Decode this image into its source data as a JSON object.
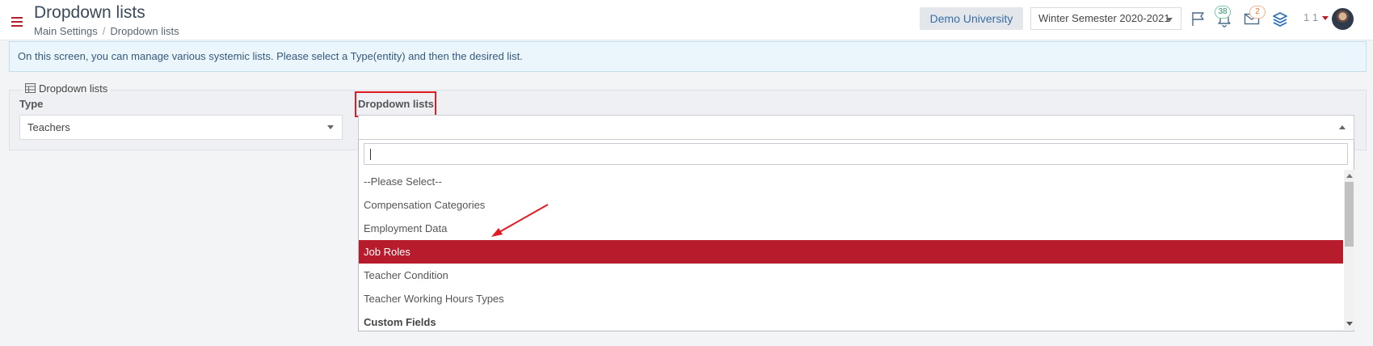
{
  "header": {
    "title": "Dropdown lists",
    "breadcrumb": [
      "Main Settings",
      "Dropdown lists"
    ],
    "university": "Demo University",
    "semester": "Winter Semester 2020-2021",
    "notifications_count": "38",
    "messages_count": "2",
    "user_number": "1 1"
  },
  "info": {
    "text": "On this screen, you can manage various systemic lists. Please select a Type(entity) and then the desired list."
  },
  "panel": {
    "legend": "Dropdown lists",
    "type_label": "Type",
    "type_value": "Teachers",
    "list_label": "Dropdown lists",
    "list_value": ""
  },
  "dropdown": {
    "search_value": "",
    "options": [
      {
        "label": "--Please Select--"
      },
      {
        "label": "Compensation Categories"
      },
      {
        "label": "Employment Data"
      },
      {
        "label": "Job Roles",
        "selected": true
      },
      {
        "label": "Teacher Condition"
      },
      {
        "label": "Teacher Working Hours Types"
      }
    ],
    "group_label": "Custom Fields"
  },
  "colors": {
    "accent": "#b71c2c",
    "highlight_box": "#e11b22",
    "annotation_arrow": "#e11b22"
  },
  "icons": [
    "hamburger-icon",
    "flag-icon",
    "bell-icon",
    "envelope-icon",
    "layers-icon",
    "table-icon"
  ]
}
